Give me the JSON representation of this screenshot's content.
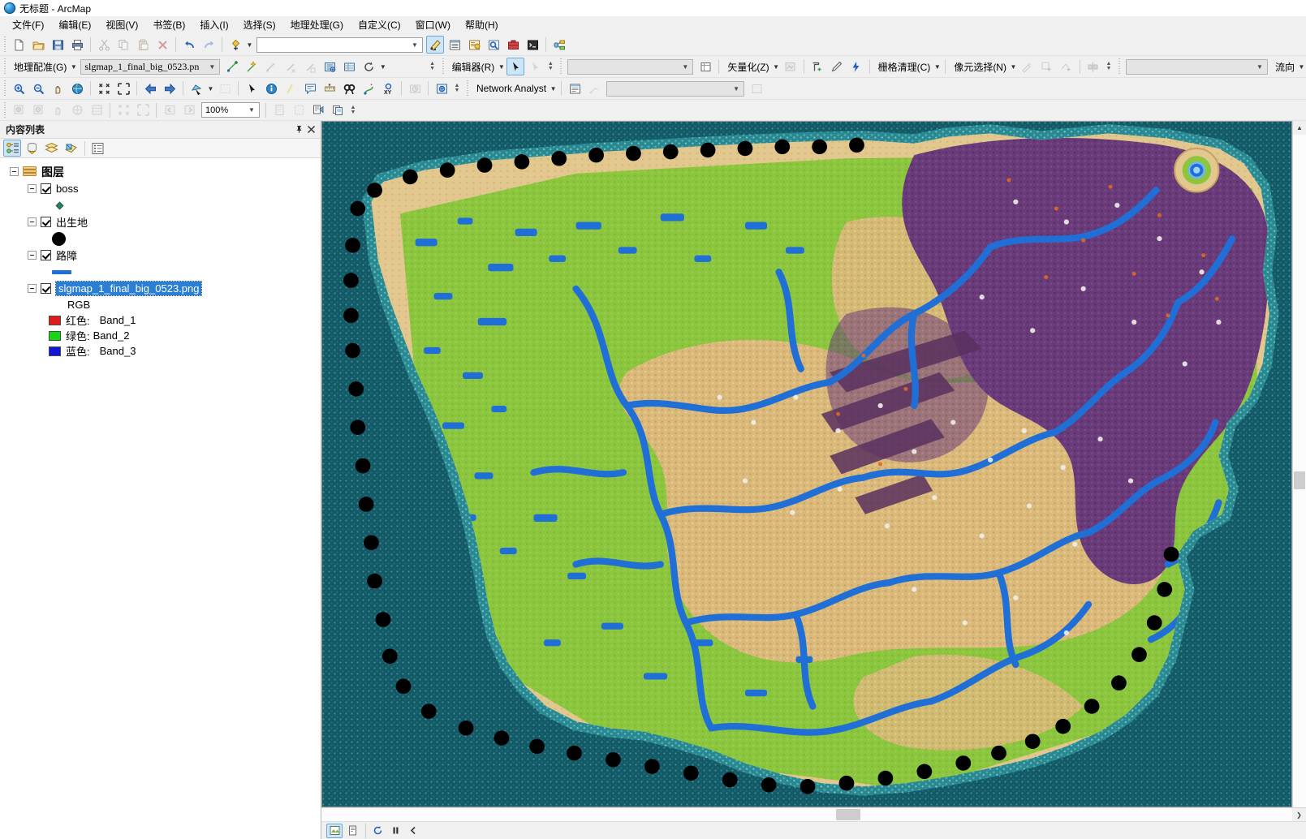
{
  "window": {
    "title": "无标题 - ArcMap",
    "app_icon": "arcmap-globe-icon"
  },
  "menubar": {
    "items": [
      {
        "label": "文件(F)",
        "name": "menu-file"
      },
      {
        "label": "编辑(E)",
        "name": "menu-edit"
      },
      {
        "label": "视图(V)",
        "name": "menu-view"
      },
      {
        "label": "书签(B)",
        "name": "menu-bookmarks"
      },
      {
        "label": "插入(I)",
        "name": "menu-insert"
      },
      {
        "label": "选择(S)",
        "name": "menu-selection"
      },
      {
        "label": "地理处理(G)",
        "name": "menu-geoprocessing"
      },
      {
        "label": "自定义(C)",
        "name": "menu-customize"
      },
      {
        "label": "窗口(W)",
        "name": "menu-window"
      },
      {
        "label": "帮助(H)",
        "name": "menu-help"
      }
    ]
  },
  "toolbars": {
    "standard": {
      "combo_value": "",
      "combo_placeholder": "",
      "buttons": [
        "new-document-icon",
        "open-icon",
        "save-icon",
        "print-icon",
        "cut-icon",
        "copy-icon",
        "paste-icon",
        "delete-icon",
        "undo-icon",
        "redo-icon",
        "add-data-icon"
      ],
      "right_buttons": [
        "editor-toolbar-icon",
        "table-of-contents-icon",
        "catalog-icon",
        "search-icon",
        "arctoolbox-icon",
        "python-window-icon",
        "modelbuilder-icon"
      ]
    },
    "georeferencing": {
      "menu_label": "地理配准(G)",
      "layer_combo_value": "slgmap_1_final_big_0523.pn",
      "buttons": [
        "add-control-points-icon",
        "auto-register-icon",
        "view-link-table-icon",
        "delete-link-icon",
        "select-link-icon",
        "fit-to-display-icon",
        "update-georeferencing-icon",
        "rotate-icon"
      ]
    },
    "editor": {
      "menu_label": "编辑器(R)",
      "buttons": [
        "edit-tool-icon",
        "edit-annotation-icon"
      ],
      "task_combo_value": "",
      "vectorize_label": "矢量化(Z)",
      "raster_cleanup_label": "栅格清理(C)",
      "pixel_select_label": "像元选择(N)",
      "flow_label": "流向",
      "flow_combo_value": ""
    },
    "tools": {
      "buttons": [
        "zoom-in-icon",
        "zoom-out-icon",
        "pan-icon",
        "full-extent-icon",
        "fixed-zoom-in-icon",
        "fixed-zoom-out-icon",
        "previous-extent-icon",
        "next-extent-icon",
        "select-features-icon",
        "clear-selection-icon",
        "select-elements-icon",
        "identify-icon",
        "hyperlink-icon",
        "html-popup-icon",
        "measure-icon",
        "find-icon",
        "find-route-icon",
        "go-to-xy-icon",
        "time-slider-icon",
        "create-viewer-window-icon"
      ],
      "network_analyst_label": "Network Analyst"
    },
    "layout": {
      "zoom_value": "100%",
      "buttons": [
        "layout-zoom-in-icon",
        "layout-zoom-out-icon",
        "layout-pan-icon",
        "zoom-whole-page-icon",
        "fixed-zoom-in-layout-icon",
        "zoom-to-100-icon",
        "zoom-to-selected-icon",
        "go-back-extent-icon",
        "go-forward-extent-icon",
        "toggle-draft-mode-icon",
        "focus-data-frame-icon",
        "change-layout-icon",
        "data-driven-pages-icon"
      ]
    }
  },
  "toc": {
    "title": "内容列表",
    "pin_icon": "pin-icon",
    "close_icon": "close-icon",
    "toolbar_buttons": [
      {
        "name": "list-by-drawing-order-button",
        "icon": "drawing-order-icon",
        "active": true
      },
      {
        "name": "list-by-source-button",
        "icon": "source-icon",
        "active": false
      },
      {
        "name": "list-by-visibility-button",
        "icon": "visibility-icon",
        "active": false
      },
      {
        "name": "list-by-selection-button",
        "icon": "selection-icon",
        "active": false
      },
      {
        "name": "toc-options-button",
        "icon": "options-icon",
        "active": false
      }
    ],
    "root": {
      "label": "图层",
      "checked": true,
      "expanded": true
    },
    "layers": [
      {
        "label": "boss",
        "checked": true,
        "expanded": true,
        "symbol": "diamond",
        "symbol_color": "#2f7d63"
      },
      {
        "label": "出生地",
        "checked": true,
        "expanded": true,
        "symbol": "dot",
        "symbol_color": "#000000"
      },
      {
        "label": "路障",
        "checked": true,
        "expanded": true,
        "symbol": "line",
        "symbol_color": "#1f6fd6"
      }
    ],
    "raster": {
      "label": "slgmap_1_final_big_0523.png",
      "checked": true,
      "expanded": true,
      "selected": true,
      "renderer_label": "RGB",
      "bands": [
        {
          "color_label": "红色:",
          "band": "Band_1",
          "swatch": "#e01b1b"
        },
        {
          "color_label": "绿色:",
          "band": "Band_2",
          "swatch": "#14d814"
        },
        {
          "color_label": "蓝色:",
          "band": "Band_3",
          "swatch": "#1515d8"
        }
      ]
    }
  },
  "map": {
    "name": "slg-game-world-map",
    "colors": {
      "ocean": "#145966",
      "ocean_speckle": "#3fb4b8",
      "shallow_water": "#37a0a5",
      "beach_sand": "#e2c88e",
      "grassland": "#8cc63f",
      "grass_dark": "#6fae33",
      "desert": "#ddb97c",
      "desert_dark": "#c49a5e",
      "corruption_purple": "#6a3b7a",
      "corruption_dark": "#4e2b5c",
      "river_blue": "#1f6fd6",
      "lake_blue": "#1f6fd6",
      "spawn_point": "#000000",
      "mountain_white": "#f0efe8"
    },
    "features": {
      "spawn_points_label": "出生地",
      "boss_label": "boss",
      "barrier_label": "路障",
      "oasis_label": "oasis"
    }
  },
  "statusbar": {
    "buttons": [
      {
        "name": "data-view-button",
        "icon": "data-view-icon",
        "active": true
      },
      {
        "name": "layout-view-button",
        "icon": "layout-view-icon",
        "active": false
      },
      {
        "name": "refresh-view-button",
        "icon": "refresh-icon",
        "active": false
      },
      {
        "name": "pause-drawing-button",
        "icon": "pause-icon",
        "active": false
      },
      {
        "name": "back-button",
        "icon": "chevron-left-icon",
        "active": false
      }
    ],
    "message": ""
  },
  "scrollbars": {
    "vertical": {
      "thumb_top_pct": 50
    },
    "horizontal": {
      "thumb_left_pct": 53
    }
  }
}
